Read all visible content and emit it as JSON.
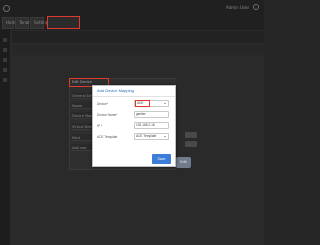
{
  "topbar": {
    "tabs": [
      "Home",
      "Tenants",
      "Settings"
    ],
    "highlighted_tab": "",
    "user_menu": "Admin User"
  },
  "main": {
    "row_text": ""
  },
  "left_panel": {
    "title": "Edit Device",
    "labels": [
      "General Details",
      "Name",
      "Device Mapping",
      "Virtual Devices",
      "Next",
      "Add row"
    ]
  },
  "edit_button_label": "Edit",
  "modal": {
    "title": "Add Device Mapping",
    "fields": [
      {
        "label": "Device*",
        "value": "ADE"
      },
      {
        "label": "Device Name*",
        "value": "gentler"
      },
      {
        "label": "IP *",
        "value": "192.168.2.18"
      },
      {
        "label": "ACE Template",
        "value": "ACE Template"
      }
    ],
    "save_label": "Save"
  }
}
